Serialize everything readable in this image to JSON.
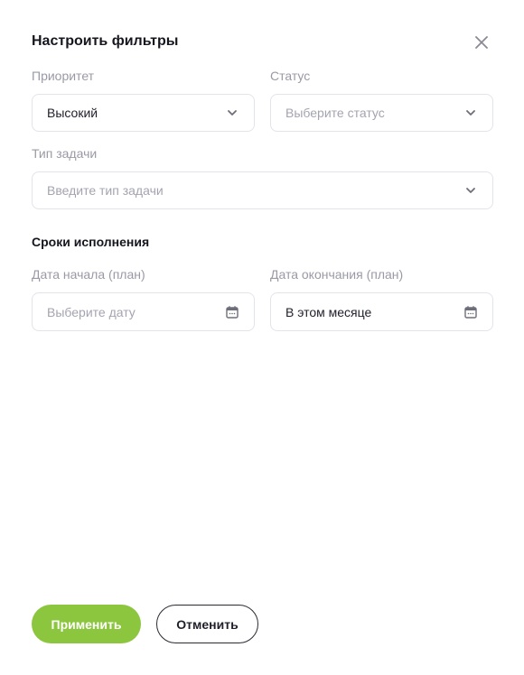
{
  "dialog": {
    "title": "Настроить фильтры",
    "close_icon": "close-icon"
  },
  "filters": {
    "priority": {
      "label": "Приоритет",
      "value": "Высокий",
      "icon": "chevron-down-icon"
    },
    "status": {
      "label": "Статус",
      "placeholder": "Выберите статус",
      "icon": "chevron-down-icon"
    },
    "task_type": {
      "label": "Тип задачи",
      "placeholder": "Введите тип задачи",
      "icon": "chevron-down-icon"
    }
  },
  "deadlines": {
    "section_title": "Сроки исполнения",
    "start_date": {
      "label": "Дата начала (план)",
      "placeholder": "Выберите дату",
      "icon": "calendar-icon"
    },
    "end_date": {
      "label": "Дата окончания (план)",
      "value": "В этом месяце",
      "icon": "calendar-icon"
    }
  },
  "actions": {
    "apply_label": "Применить",
    "cancel_label": "Отменить"
  },
  "colors": {
    "accent": "#8cc63f",
    "border": "#e3e3ea",
    "muted_text": "#9a9aa6",
    "text": "#1f1f2a"
  }
}
